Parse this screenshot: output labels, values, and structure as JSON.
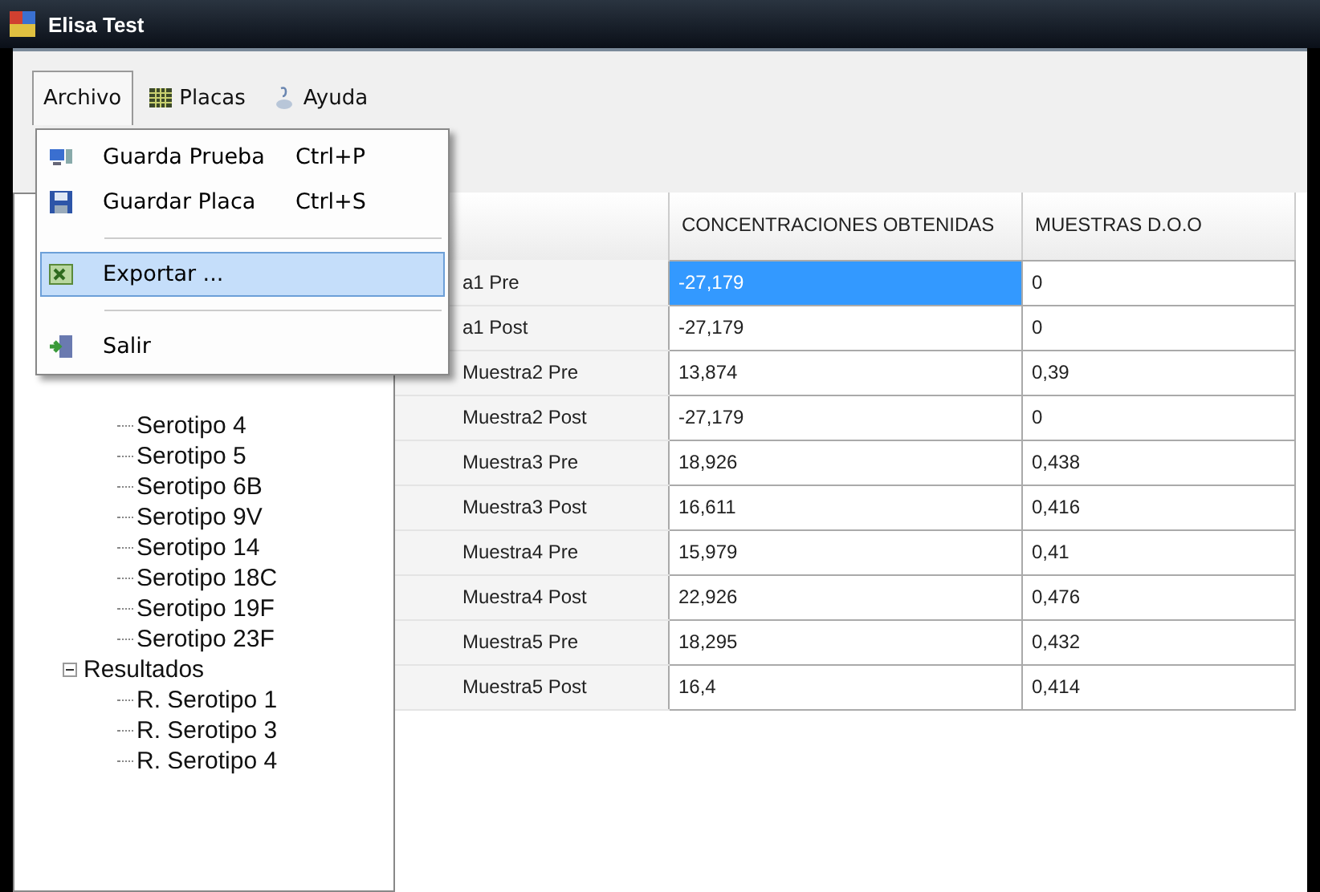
{
  "window": {
    "title": "Elisa Test"
  },
  "menubar": [
    {
      "label": "Archivo",
      "selected": true
    },
    {
      "label": "Placas",
      "selected": false
    },
    {
      "label": "Ayuda",
      "selected": false
    }
  ],
  "menu": [
    {
      "kind": "item",
      "label": "Guarda Prueba",
      "shortcut": "Ctrl+P",
      "selected": false
    },
    {
      "kind": "item",
      "label": "Guardar Placa",
      "shortcut": "Ctrl+S",
      "selected": false
    },
    {
      "kind": "separator"
    },
    {
      "kind": "item",
      "label": "Exportar ...",
      "selected": true
    },
    {
      "kind": "separator"
    },
    {
      "kind": "item",
      "label": "Salir",
      "selected": false
    }
  ],
  "tree": [
    {
      "children": [
        {
          "label": "Serotipo 4"
        },
        {
          "label": "Serotipo 5"
        },
        {
          "label": "Serotipo 6B"
        },
        {
          "label": "Serotipo 9V"
        },
        {
          "label": "Serotipo 14"
        },
        {
          "label": "Serotipo 18C"
        },
        {
          "label": "Serotipo 19F"
        },
        {
          "label": "Serotipo 23F"
        }
      ]
    },
    {
      "label": "Resultados",
      "expanded": true,
      "children": [
        {
          "label": "R. Serotipo 1"
        },
        {
          "label": "R. Serotipo 3"
        },
        {
          "label": "R. Serotipo 4"
        }
      ]
    }
  ],
  "table": {
    "columns": [
      "CONCENTRACIONES OBTENIDAS",
      "MUESTRAS D.O.O"
    ],
    "rows": [
      {
        "header": "a1 Pre",
        "cells": [
          {
            "text": "-27,179",
            "selected": true
          },
          {
            "text": "0",
            "selected": false
          }
        ]
      },
      {
        "header": "a1 Post",
        "cells": [
          {
            "text": "-27,179",
            "selected": false
          },
          {
            "text": "0",
            "selected": false
          }
        ]
      },
      {
        "header": "Muestra2 Pre",
        "cells": [
          {
            "text": "13,874",
            "selected": false
          },
          {
            "text": "0,39",
            "selected": false
          }
        ]
      },
      {
        "header": "Muestra2 Post",
        "cells": [
          {
            "text": "-27,179",
            "selected": false
          },
          {
            "text": "0",
            "selected": false
          }
        ]
      },
      {
        "header": "Muestra3 Pre",
        "cells": [
          {
            "text": "18,926",
            "selected": false
          },
          {
            "text": "0,438",
            "selected": false
          }
        ]
      },
      {
        "header": "Muestra3 Post",
        "cells": [
          {
            "text": "16,611",
            "selected": false
          },
          {
            "text": "0,416",
            "selected": false
          }
        ]
      },
      {
        "header": "Muestra4 Pre",
        "cells": [
          {
            "text": "15,979",
            "selected": false
          },
          {
            "text": "0,41",
            "selected": false
          }
        ]
      },
      {
        "header": "Muestra4 Post",
        "cells": [
          {
            "text": "22,926",
            "selected": false
          },
          {
            "text": "0,476",
            "selected": false
          }
        ]
      },
      {
        "header": "Muestra5 Pre",
        "cells": [
          {
            "text": "18,295",
            "selected": false
          },
          {
            "text": "0,432",
            "selected": false
          }
        ]
      },
      {
        "header": "Muestra5 Post",
        "cells": [
          {
            "text": "16,4",
            "selected": false
          },
          {
            "text": "0,414",
            "selected": false
          }
        ]
      }
    ]
  }
}
